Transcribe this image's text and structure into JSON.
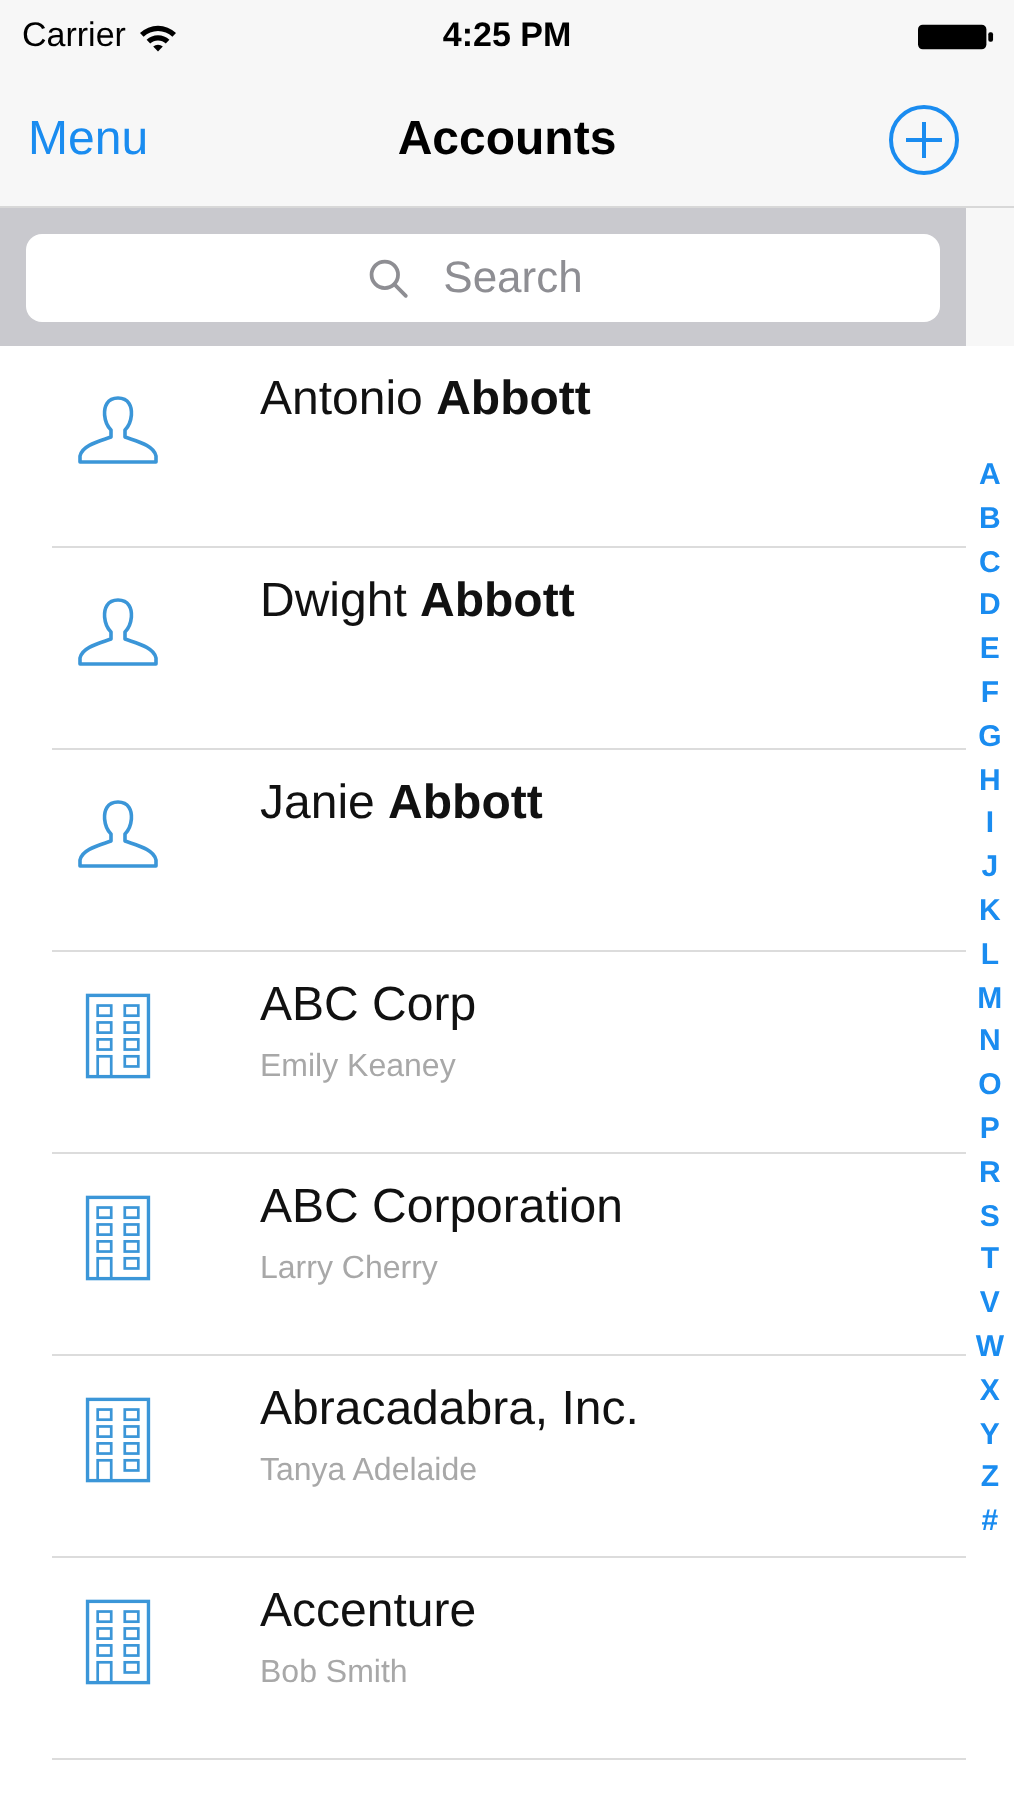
{
  "status_bar": {
    "carrier": "Carrier",
    "time": "4:25 PM"
  },
  "nav_bar": {
    "left_button": "Menu",
    "title": "Accounts"
  },
  "search": {
    "placeholder": "Search"
  },
  "accounts": [
    {
      "kind": "person",
      "name": "Antonio **Abbott**"
    },
    {
      "kind": "person",
      "name": "Dwight **Abbott**"
    },
    {
      "kind": "person",
      "name": "Janie **Abbott**"
    },
    {
      "kind": "company",
      "name": "ABC Corp",
      "contact": "Emily Keaney"
    },
    {
      "kind": "company",
      "name": "ABC Corporation",
      "contact": "Larry Cherry"
    },
    {
      "kind": "company",
      "name": "Abracadabra, Inc.",
      "contact": "Tanya Adelaide"
    },
    {
      "kind": "company",
      "name": "Accenture",
      "contact": "Bob Smith"
    }
  ],
  "section_index": [
    "A",
    "B",
    "C",
    "D",
    "E",
    "F",
    "G",
    "H",
    "I",
    "J",
    "K",
    "L",
    "M",
    "N",
    "O",
    "P",
    "R",
    "S",
    "T",
    "V",
    "W",
    "X",
    "Y",
    "Z",
    "#"
  ]
}
